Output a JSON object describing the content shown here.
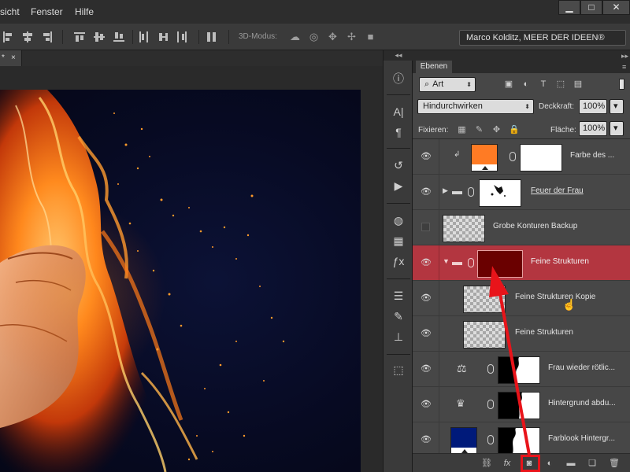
{
  "menubar": {
    "items": [
      "sicht",
      "Fenster",
      "Hilfe"
    ],
    "window_buttons": [
      "▁",
      "□",
      "✕"
    ]
  },
  "optionsbar": {
    "mode3d_label": "3D-Modus:",
    "workspace": "Marco Kolditz, MEER DER IDEEN®"
  },
  "document": {
    "tab_label": "*",
    "tab_close": "×"
  },
  "toolcol": {
    "collapse_glyph": "◂◂",
    "tools": [
      "info-icon",
      "character-icon",
      "paragraph-icon",
      "history-icon",
      "actions-icon",
      "swatches-icon",
      "navigator-icon",
      "styles-icon",
      "adjustments-icon",
      "brush-presets-icon",
      "clone-source-icon",
      "3d-icon"
    ]
  },
  "layers_panel": {
    "tab_label": "Ebenen",
    "collapse_glyph": "▸▸",
    "menu_glyph": "≡",
    "filter": {
      "value": "Art",
      "search_glyph": "⌕"
    },
    "blend_mode": "Hindurchwirken",
    "opacity_label": "Deckkraft:",
    "opacity_value": "100%",
    "lock_label": "Fixieren:",
    "fill_label": "Fläche:",
    "fill_value": "100%",
    "layers": [
      {
        "name": "Farbe des ...",
        "visible": true,
        "selected": false
      },
      {
        "name": "Feuer der Frau",
        "visible": true,
        "selected": false
      },
      {
        "name": "Grobe Konturen Backup",
        "visible": false,
        "selected": false
      },
      {
        "name": "Feine Strukturen",
        "visible": true,
        "selected": true
      },
      {
        "name": "Feine Strukturen Kopie",
        "visible": true,
        "selected": false
      },
      {
        "name": "Feine Strukturen",
        "visible": true,
        "selected": false
      },
      {
        "name": "Frau wieder rötlic...",
        "visible": true,
        "selected": false
      },
      {
        "name": "Hintergrund abdu...",
        "visible": true,
        "selected": false
      },
      {
        "name": "Farblook Hintergr...",
        "visible": true,
        "selected": false
      }
    ],
    "bottom_icons": [
      "link-icon",
      "fx-icon",
      "add-mask-icon",
      "adjustment-layer-icon",
      "group-icon",
      "new-layer-icon",
      "trash-icon"
    ],
    "bottom_glyphs": {
      "fx": "fx"
    }
  },
  "colors": {
    "selected_row": "#b33640",
    "group_fill": "#6a0000",
    "orange_fill": "#ff7b24",
    "blue_fill": "#001a7a",
    "annotation": "#e8141a",
    "canvas_bg": "#070a22"
  }
}
